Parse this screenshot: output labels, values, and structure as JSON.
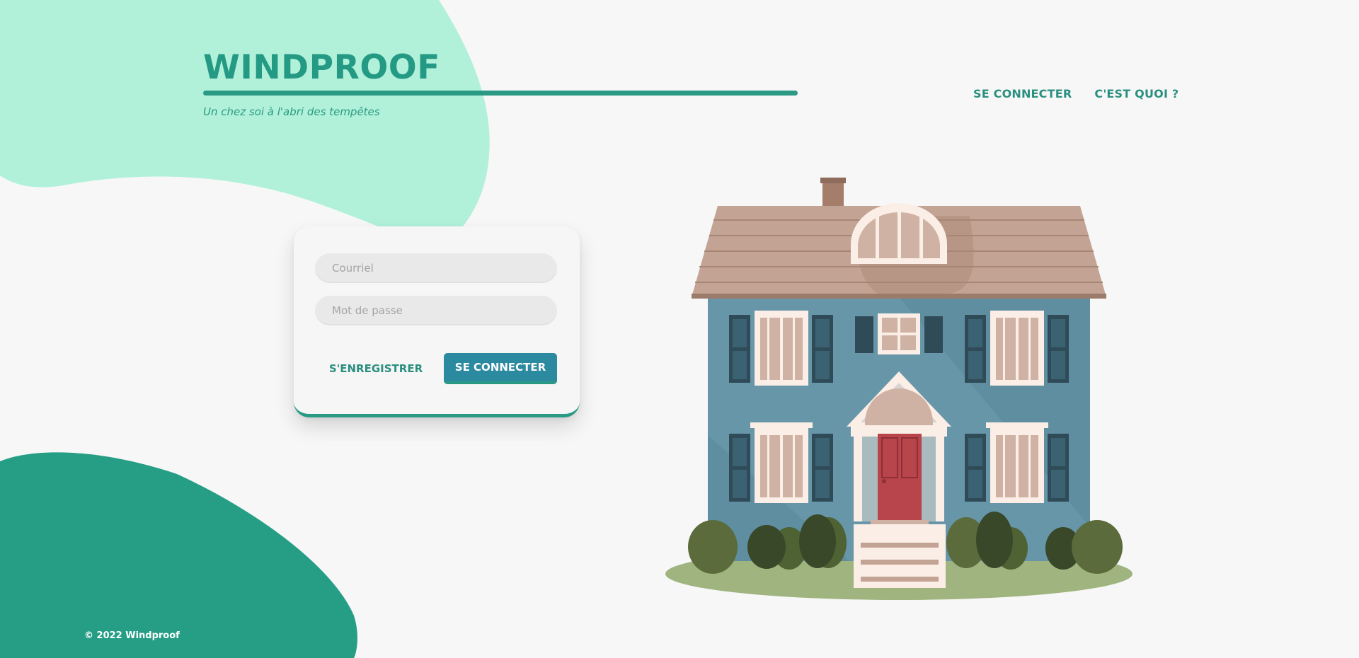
{
  "brand": {
    "title": "WINDPROOF",
    "tagline": "Un chez soi à l'abri des tempêtes"
  },
  "nav": {
    "login": "SE CONNECTER",
    "about": "C'EST QUOI ?"
  },
  "login_form": {
    "email_placeholder": "Courriel",
    "password_placeholder": "Mot de passe",
    "register_label": "S'ENREGISTRER",
    "submit_label": "SE CONNECTER"
  },
  "footer": {
    "copyright": "© 2022 Windproof"
  },
  "colors": {
    "accent": "#2a9a84",
    "blob_light": "#b1f1da",
    "blob_dark": "#259e85",
    "button": "#2c8aa0",
    "background": "#f7f7f7"
  },
  "illustration": {
    "name": "house-illustration"
  }
}
